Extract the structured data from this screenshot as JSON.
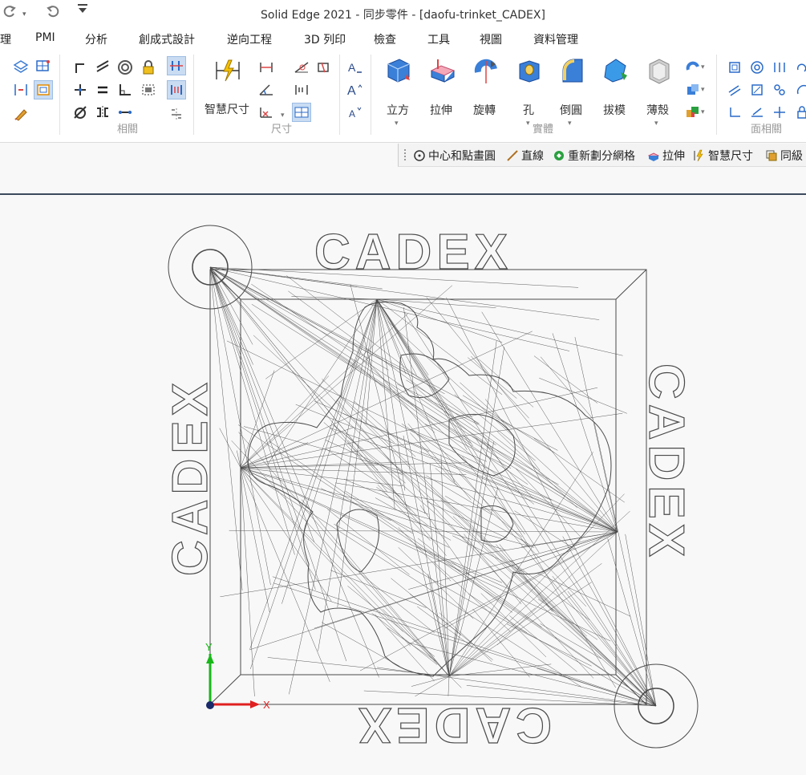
{
  "window": {
    "title": "Solid Edge 2021 - 同步零件 - [daofu-trinket_CADEX]"
  },
  "quick_access": {
    "items": [
      "redo-icon",
      "undo-icon",
      "customize-icon"
    ]
  },
  "menu": {
    "tabs": [
      "理",
      "PMI",
      "分析",
      "創成式設計",
      "逆向工程",
      "3D 列印",
      "檢查",
      "工具",
      "視圖",
      "資料管理"
    ]
  },
  "ribbon": {
    "groups": {
      "relate": "相關",
      "dimension": "尺寸",
      "solids": "實體",
      "face_relate": "面相關"
    },
    "buttons": {
      "smart_dim": "智慧尺寸",
      "cube": "立方",
      "extrude": "拉伸",
      "revolve": "旋轉",
      "hole": "孔",
      "round": "倒圓",
      "draft": "拔模",
      "thin_wall": "薄殼"
    }
  },
  "command_bar": {
    "items": [
      {
        "label": "中心和點畫圓",
        "icon": "circle-center-point-icon"
      },
      {
        "label": "直線",
        "icon": "line-icon"
      },
      {
        "label": "重新劃分網格",
        "icon": "remesh-icon"
      },
      {
        "label": "拉伸",
        "icon": "extrude-icon"
      },
      {
        "label": "智慧尺寸",
        "icon": "smart-dimension-icon"
      },
      {
        "label": "同級",
        "icon": "same-level-icon"
      }
    ]
  },
  "viewport": {
    "model_text": "CADEX",
    "axes": {
      "x_label": "X",
      "y_label": "Y"
    },
    "colors": {
      "x_axis": "#e02020",
      "y_axis": "#18b818",
      "mesh": "#4a4a4a",
      "background": "#f8f8f8"
    }
  }
}
